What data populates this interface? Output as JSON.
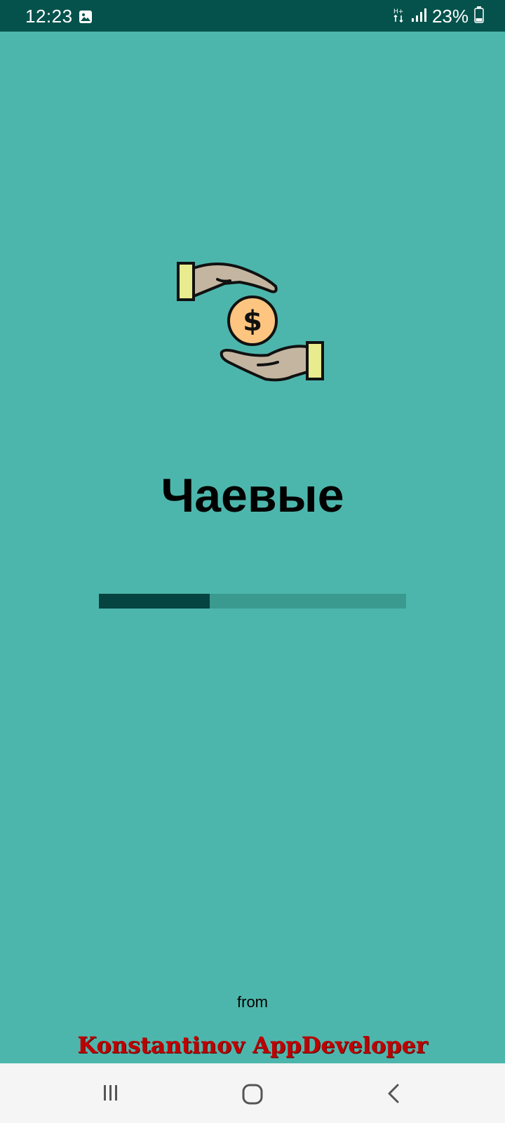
{
  "status_bar": {
    "time": "12:23",
    "battery": "23%",
    "background": "#05524c",
    "icons": [
      "image-icon",
      "data-transfer-icon",
      "signal-icon",
      "battery-icon"
    ]
  },
  "splash": {
    "logo_icon": "hands-coin-icon",
    "title": "Чаевые",
    "progress": 0.36,
    "progress_color": "#054440",
    "track_color": "#3a9a90",
    "from_label": "from",
    "developer": "Konstantinov AppDeveloper",
    "developer_color": "#c00000",
    "background": "#4db6ac"
  },
  "nav_bar": {
    "buttons": [
      "recent-apps-icon",
      "home-icon",
      "back-icon"
    ]
  }
}
